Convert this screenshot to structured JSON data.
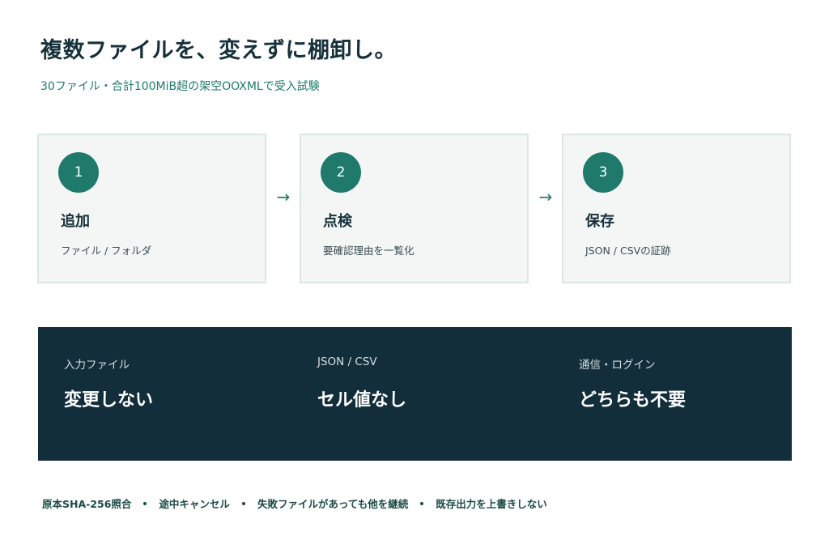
{
  "header": {
    "title": "複数ファイルを、変えずに棚卸し。",
    "subtitle": "30ファイル・合計100MiB超の架空OOXMLで受入試験"
  },
  "steps": [
    {
      "number": "1",
      "title": "追加",
      "desc": "ファイル / フォルダ"
    },
    {
      "number": "2",
      "title": "点検",
      "desc": "要確認理由を一覧化"
    },
    {
      "number": "3",
      "title": "保存",
      "desc": "JSON / CSVの証跡"
    }
  ],
  "arrow_glyph": "→",
  "facts": [
    {
      "label": "入力ファイル",
      "value": "変更しない"
    },
    {
      "label": "JSON / CSV",
      "value": "セル値なし"
    },
    {
      "label": "通信・ログイン",
      "value": "どちらも不要"
    }
  ],
  "footer": [
    "原本SHA-256照合",
    "途中キャンセル",
    "失敗ファイルがあっても他を継続",
    "既存出力を上書きしない"
  ],
  "colors": {
    "accent": "#1f7a6c",
    "panel": "#132e3b",
    "card_bg": "#f3f6f5",
    "card_border": "#dbe7e4",
    "text": "#17313b"
  }
}
